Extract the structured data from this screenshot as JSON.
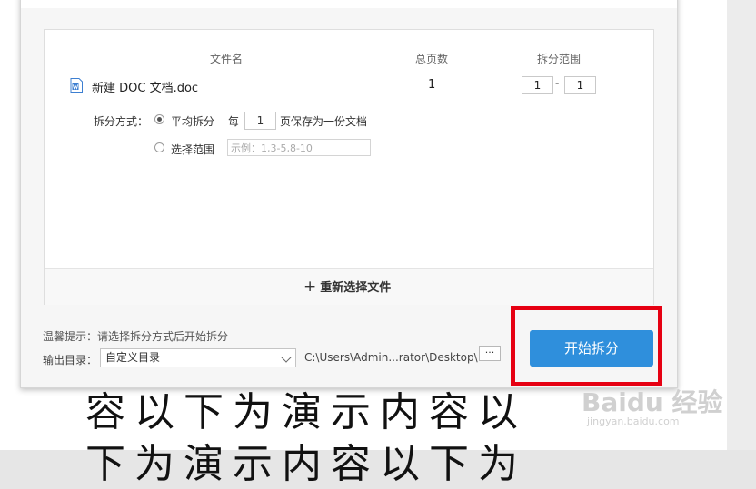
{
  "table": {
    "headers": {
      "filename": "文件名",
      "pages": "总页数",
      "range": "拆分范围"
    },
    "row": {
      "filename": "新建 DOC 文档.doc",
      "pages": "1",
      "range_from": "1",
      "range_to": "1"
    }
  },
  "split": {
    "mode_label": "拆分方式：",
    "option_average": "平均拆分",
    "per_prefix": "每",
    "per_value": "1",
    "per_suffix": "页保存为一份文档",
    "option_range": "选择范围",
    "range_placeholder": "示例：1,3-5,8-10",
    "selected": "平均拆分"
  },
  "reselect": {
    "plus": "+",
    "label": "重新选择文件"
  },
  "footer": {
    "tip": "温馨提示：请选择拆分方式后开始拆分",
    "output_label": "输出目录：",
    "output_option": "自定义目录",
    "path": "C:\\Users\\Admin...rator\\Desktop\\",
    "more": "···",
    "start": "开始拆分"
  },
  "background": {
    "line1": "容以下为演示内容以",
    "line2": "下为演示内容以下为"
  },
  "watermark": {
    "main": "Baidu 经验",
    "sub": "jingyan.baidu.com"
  },
  "colors": {
    "accent": "#2f8fdc",
    "highlight": "#e60012"
  },
  "icons": {
    "file": "word-doc-icon"
  }
}
